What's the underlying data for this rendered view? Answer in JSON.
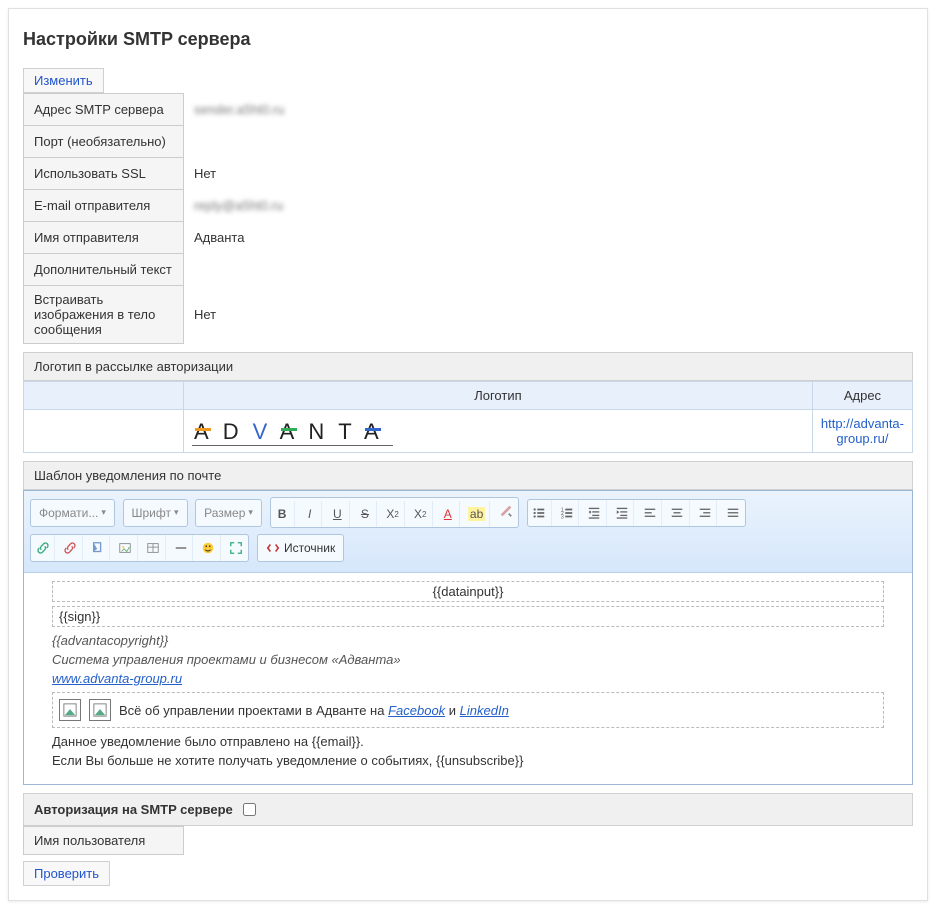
{
  "title": "Настройки SMTP сервера",
  "buttons": {
    "edit": "Изменить",
    "check": "Проверить",
    "source": "Источник"
  },
  "fields": {
    "smtp_addr_label": "Адрес SMTP сервера",
    "smtp_addr_value": "sender.a5ht0.ru",
    "port_label": "Порт (необязательно)",
    "port_value": "",
    "ssl_label": "Использовать SSL",
    "ssl_value": "Нет",
    "from_email_label": "E-mail отправителя",
    "from_email_value": "reply@a5ht0.ru",
    "from_name_label": "Имя отправителя",
    "from_name_value": "Адванта",
    "extra_text_label": "Дополнительный текст",
    "extra_text_value": "",
    "inline_img_label": "Встраивать изображения в тело сообщения",
    "inline_img_value": "Нет"
  },
  "logo_section": {
    "header": "Логотип в рассылке авторизации",
    "col_logo": "Логотип",
    "col_addr": "Адрес",
    "logo_text": "ADVANTA",
    "addr": "http://advanta-group.ru/"
  },
  "template_section": {
    "header": "Шаблон уведомления по почте",
    "toolbar": {
      "format": "Формати...",
      "font": "Шрифт",
      "size": "Размер"
    },
    "body": {
      "datainput": "{{datainput}}",
      "sign": "{{sign}}",
      "copyright": "{{advantacopyright}}",
      "system_line": "Система управления проектами и бизнесом «Адванта»",
      "site_link": "www.advanta-group.ru",
      "social_prefix": "Всё об управлении проектами в Адванте на ",
      "facebook": "Facebook",
      "and": " и ",
      "linkedin": "LinkedIn",
      "footer1": "Данное уведомление было отправлено на {{email}}.",
      "footer2": "Если Вы больше не хотите получать уведомление о событиях, {{unsubscribe}}"
    }
  },
  "auth_section": {
    "header": "Авторизация на SMTP сервере",
    "username_label": "Имя пользователя"
  }
}
